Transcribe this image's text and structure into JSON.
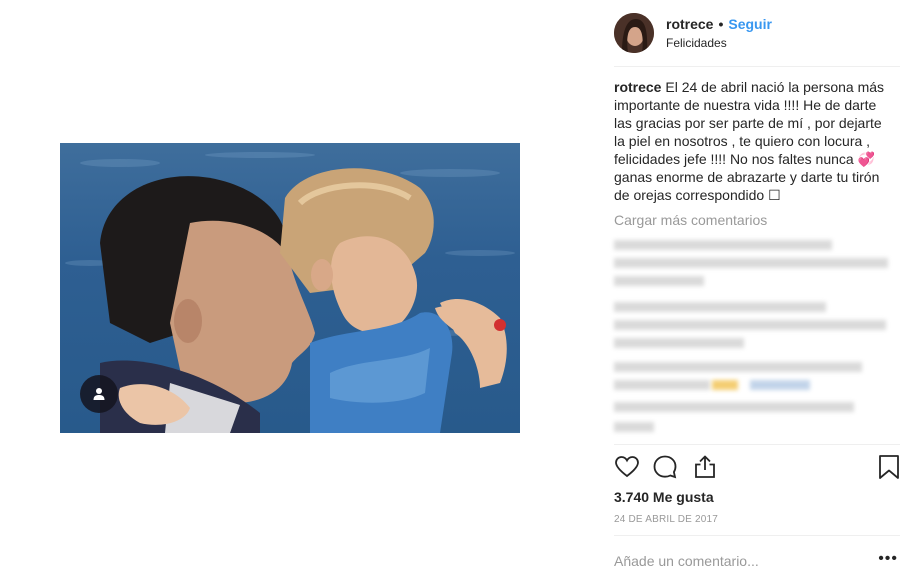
{
  "post": {
    "username": "rotrece",
    "separator": "•",
    "follow_label": "Seguir",
    "location": "Felicidades",
    "caption_user": "rotrece",
    "caption_text": "El 24 de abril nació la persona más importante de nuestra vida !!!! He de darte las gracias por ser parte de mí , por dejarte la piel en nosotros , te quiero con locura , felicidades jefe !!!! No nos faltes nunca 💞ganas enorme de abrazarte y darte tu tirón de orejas correspondido ☐",
    "load_more_label": "Cargar más comentarios",
    "likes": "3.740 Me gusta",
    "date": "24 DE ABRIL DE 2017",
    "comment_placeholder": "Añade un comentario...",
    "options_label": "•••"
  },
  "icons": {
    "tag": "user-tag-icon",
    "like": "heart-icon",
    "comment": "comment-icon",
    "share": "share-icon",
    "save": "bookmark-icon"
  },
  "colors": {
    "link": "#3897f0",
    "muted": "#999999",
    "text": "#262626"
  }
}
